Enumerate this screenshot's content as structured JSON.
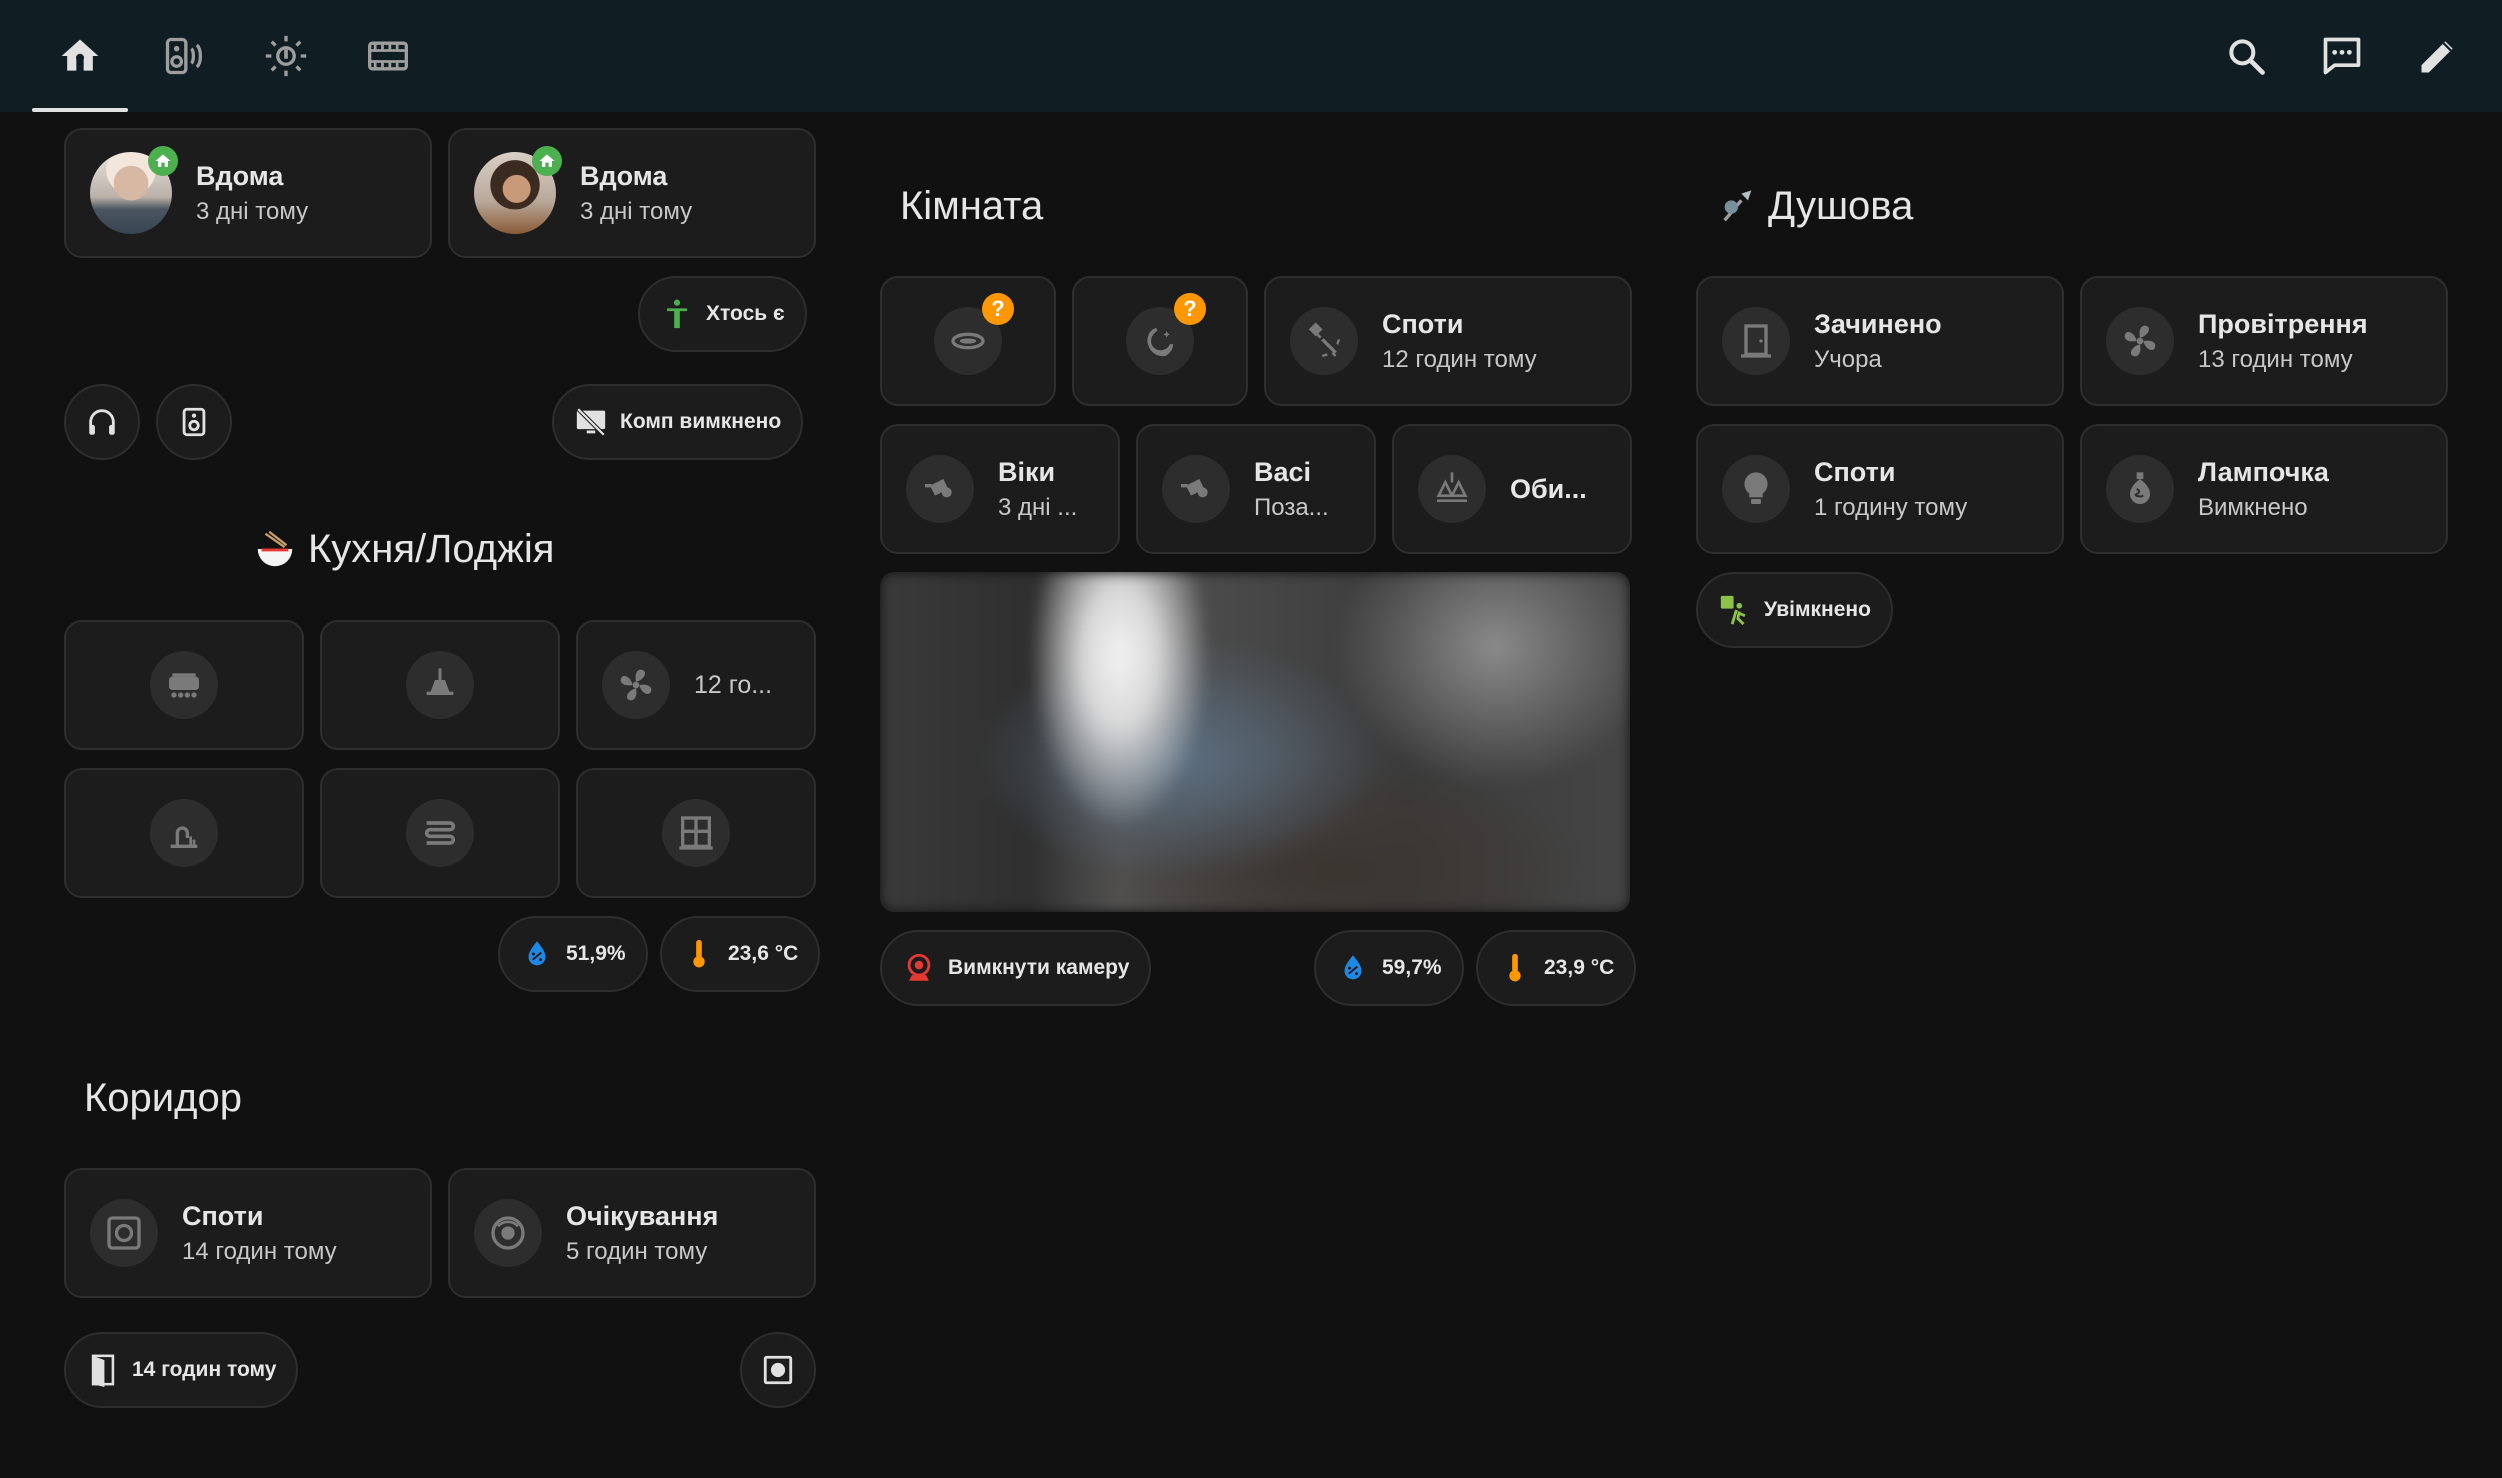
{
  "colors": {
    "topbar": "#101e24",
    "background": "#111111",
    "card": "#1c1c1c",
    "accent_orange": "#ff9800",
    "home_badge": "#4caf50",
    "humidity": "#1e88e5",
    "temperature": "#ff9800",
    "camera_off": "#e53935",
    "motion_green": "#8bc34a"
  },
  "nav": {
    "tabs": [
      {
        "icon": "home-icon",
        "active": true
      },
      {
        "icon": "speaker-icon"
      },
      {
        "icon": "sun-thermometer-icon"
      },
      {
        "icon": "video-film-icon"
      }
    ],
    "actions": [
      "search-icon",
      "assist-message-icon",
      "pencil-edit-icon"
    ]
  },
  "people": [
    {
      "state": "Вдома",
      "since": "3 дні тому",
      "icon": "person1-avatar"
    },
    {
      "state": "Вдома",
      "since": "3 дні тому",
      "icon": "person2-avatar"
    }
  ],
  "presence_chip": "Хтось є",
  "comp_chip": "Комп вимкнено",
  "kitchen": {
    "title": "Кухня/Лоджія",
    "tile_fan_label": "12 го...",
    "humidity": "51,9%",
    "temperature": "23,6 °C"
  },
  "corridor": {
    "title": "Коридор",
    "tiles": [
      {
        "title": "Споти",
        "subtitle": "14 годин тому"
      },
      {
        "title": "Очікування",
        "subtitle": "5 годин тому"
      }
    ],
    "door_chip": "14 годин тому"
  },
  "room": {
    "title": "Кімната",
    "tiles": [
      {
        "title": "Споти",
        "subtitle": "12 годин тому"
      },
      {
        "title": "Віки",
        "subtitle": "3 дні ..."
      },
      {
        "title": "Васі",
        "subtitle": "Поза..."
      },
      {
        "title": "Оби..."
      }
    ],
    "badge": "?",
    "camera_chip": "Вимкнути камеру",
    "humidity": "59,7%",
    "temperature": "23,9 °C"
  },
  "shower": {
    "title": "Душова",
    "tiles": [
      {
        "title": "Зачинено",
        "subtitle": "Учора"
      },
      {
        "title": "Провітрення",
        "subtitle": "13 годин тому"
      },
      {
        "title": "Споти",
        "subtitle": "1 годину тому"
      },
      {
        "title": "Лампочка",
        "subtitle": "Вимкнено"
      }
    ],
    "motion_chip": "Увімкнено"
  }
}
